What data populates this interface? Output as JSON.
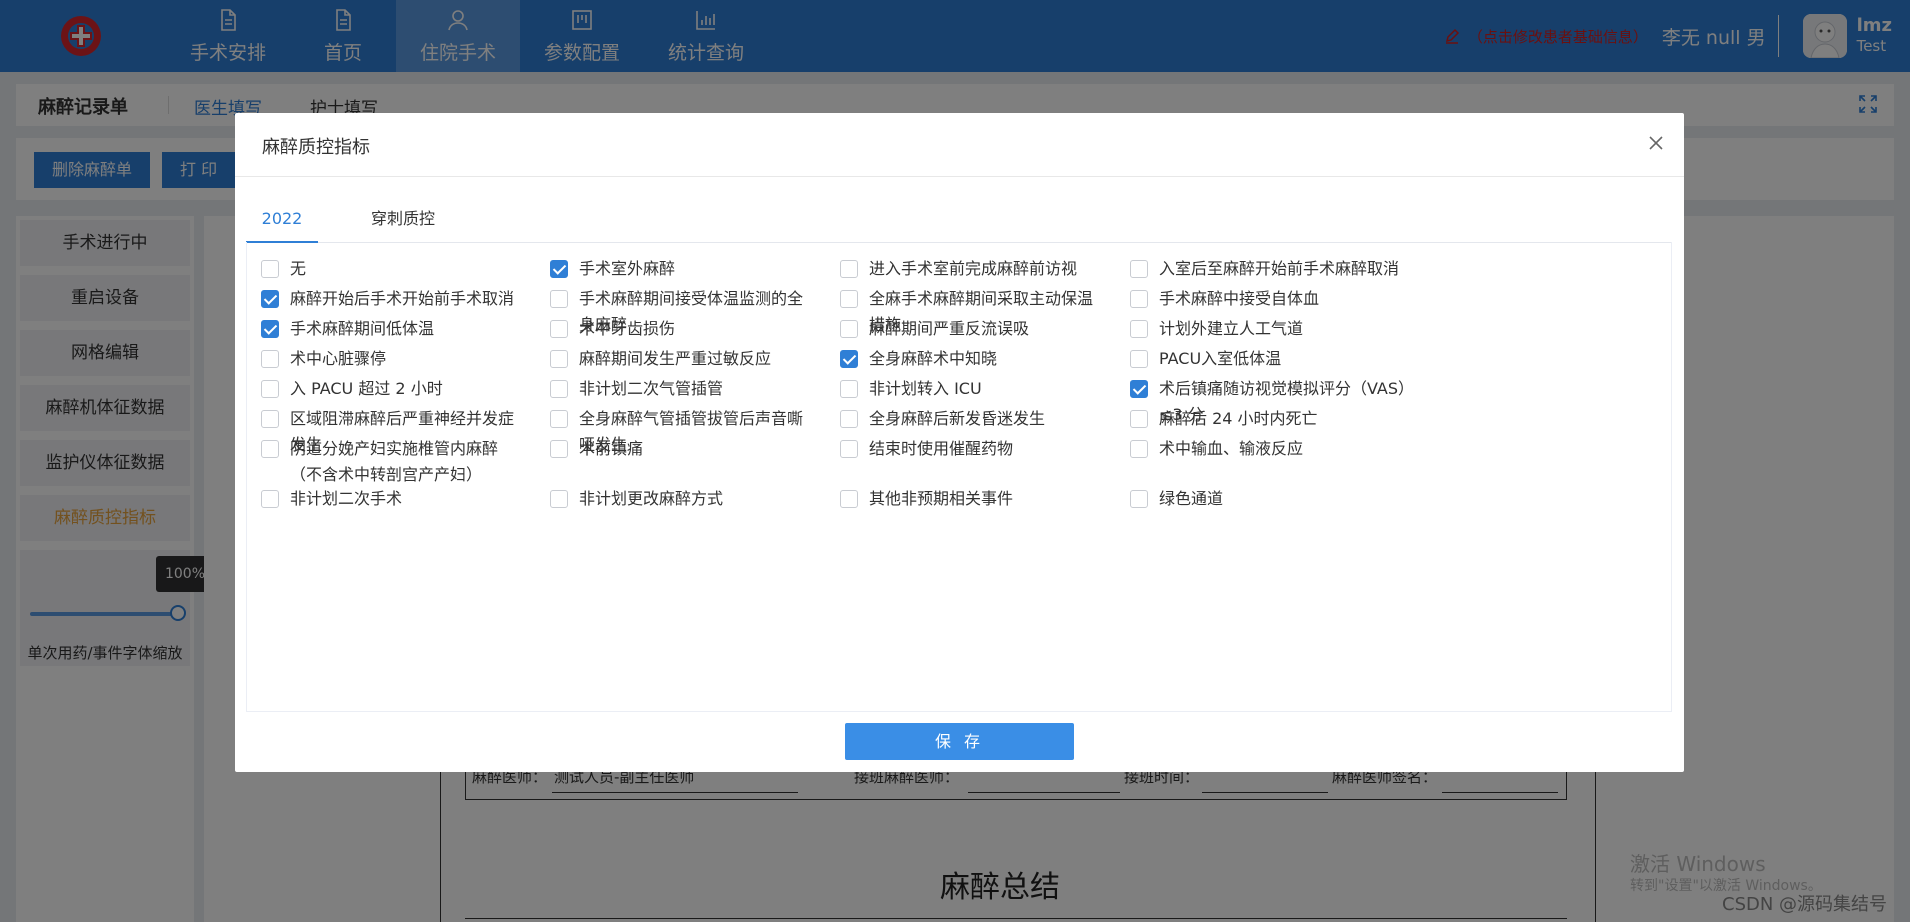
{
  "nav": {
    "items": [
      {
        "label": "手术安排",
        "icon": "document-icon"
      },
      {
        "label": "首页",
        "icon": "document-icon"
      },
      {
        "label": "住院手术",
        "icon": "user-icon"
      },
      {
        "label": "参数配置",
        "icon": "board-icon"
      },
      {
        "label": "统计查询",
        "icon": "bar-chart-icon"
      }
    ],
    "active_index": 2
  },
  "header": {
    "edit_hint": "（点击修改患者基础信息）",
    "patient_info": "李无 null 男",
    "user_name": "lmz",
    "user_role": "Test"
  },
  "page": {
    "title": "麻醉记录单",
    "tab_doctor": "医生填写",
    "tab_nurse": "护士填写",
    "btn_delete": "删除麻醉单",
    "btn_print": "打 印",
    "sidebar": [
      "手术进行中",
      "重启设备",
      "网格编辑",
      "麻醉机体征数据",
      "监护仪体征数据",
      "麻醉质控指标"
    ],
    "sidebar_active_index": 5,
    "slider": {
      "tooltip": "100%",
      "value": 1.0,
      "label": "单次用药/事件字体缩放"
    },
    "sign": {
      "anesthesiologist_label": "麻醉医师：",
      "anesthesiologist_value": "测试人员-副主任医师",
      "handover_doctor_label": "接班麻醉医师：",
      "handover_time_label": "接班时间：",
      "signature_label": "麻醉医师签名："
    },
    "summary_title": "麻醉总结",
    "watermark_title": "激活 Windows",
    "watermark_sub": "转到\"设置\"以激活 Windows。",
    "csdn": "CSDN @源码集结号"
  },
  "dialog": {
    "title": "麻醉质控指标",
    "tabs": [
      "2022",
      "穿刺质控"
    ],
    "active_tab": 0,
    "save_label": "保 存",
    "checkboxes": [
      {
        "label": "无",
        "checked": false
      },
      {
        "label": "手术室外麻醉",
        "checked": true
      },
      {
        "label": "进入手术室前完成麻醉前访视",
        "checked": false
      },
      {
        "label": "入室后至麻醉开始前手术麻醉取消",
        "checked": false
      },
      {
        "label": "麻醉开始后手术开始前手术取消",
        "checked": true
      },
      {
        "label": "手术麻醉期间接受体温监测的全身麻醉",
        "checked": false
      },
      {
        "label": "全麻手术麻醉期间采取主动保温措施",
        "checked": false
      },
      {
        "label": "手术麻醉中接受自体血",
        "checked": false
      },
      {
        "label": "手术麻醉期间低体温",
        "checked": true
      },
      {
        "label": "术中牙齿损伤",
        "checked": false
      },
      {
        "label": "麻醉期间严重反流误吸",
        "checked": false
      },
      {
        "label": "计划外建立人工气道",
        "checked": false
      },
      {
        "label": "术中心脏骤停",
        "checked": false
      },
      {
        "label": "麻醉期间发生严重过敏反应",
        "checked": false
      },
      {
        "label": "全身麻醉术中知晓",
        "checked": true
      },
      {
        "label": "PACU入室低体温",
        "checked": false
      },
      {
        "label": "入 PACU 超过 2 小时",
        "checked": false
      },
      {
        "label": "非计划二次气管插管",
        "checked": false
      },
      {
        "label": "非计划转入 ICU",
        "checked": false
      },
      {
        "label": "术后镇痛随访视觉模拟评分（VAS）≤3 分",
        "checked": true
      },
      {
        "label": "区域阻滞麻醉后严重神经并发症发生",
        "checked": false
      },
      {
        "label": "全身麻醉气管插管拔管后声音嘶哑发生",
        "checked": false
      },
      {
        "label": "全身麻醉后新发昏迷发生",
        "checked": false
      },
      {
        "label": "麻醉后 24 小时内死亡",
        "checked": false
      },
      {
        "label": "阴道分娩产妇实施椎管内麻醉（不含术中转剖宫产产妇）",
        "checked": false
      },
      {
        "label": "术前镇痛",
        "checked": false
      },
      {
        "label": "结束时使用催醒药物",
        "checked": false
      },
      {
        "label": "术中输血、输液反应",
        "checked": false
      },
      {
        "label": "非计划二次手术",
        "checked": false
      },
      {
        "label": "非计划更改麻醉方式",
        "checked": false
      },
      {
        "label": "其他非预期相关事件",
        "checked": false
      },
      {
        "label": "绿色通道",
        "checked": false
      }
    ]
  }
}
